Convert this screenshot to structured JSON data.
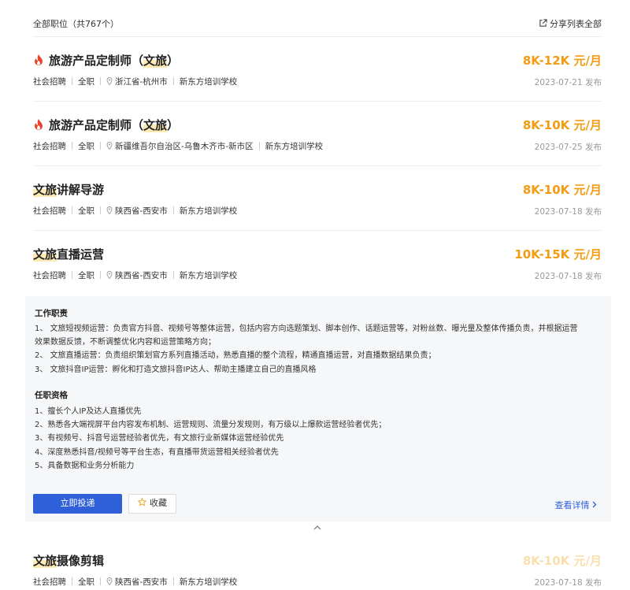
{
  "header": {
    "total_label": "全部职位（共767个）",
    "share_label": "分享列表全部",
    "share_icon": "share-icon"
  },
  "jobs": [
    {
      "hot": true,
      "title_prefix": "旅游产品定制师（",
      "title_highlight": "文旅",
      "title_suffix": "）",
      "salary": "8K-12K 元/月",
      "type": "社会招聘",
      "nature": "全职",
      "location": "浙江省-杭州市",
      "company": "新东方培训学校",
      "date": "2023-07-21 发布"
    },
    {
      "hot": true,
      "title_prefix": "旅游产品定制师（",
      "title_highlight": "文旅",
      "title_suffix": "）",
      "salary": "8K-10K 元/月",
      "type": "社会招聘",
      "nature": "全职",
      "location": "新疆维吾尔自治区-乌鲁木齐市-新市区",
      "company": "新东方培训学校",
      "date": "2023-07-25 发布"
    },
    {
      "hot": false,
      "title_prefix": "",
      "title_highlight": "文旅",
      "title_suffix": "讲解导游",
      "salary": "8K-10K 元/月",
      "type": "社会招聘",
      "nature": "全职",
      "location": "陕西省-西安市",
      "company": "新东方培训学校",
      "date": "2023-07-18 发布"
    },
    {
      "hot": false,
      "title_prefix": "",
      "title_highlight": "文旅",
      "title_suffix": "直播运营",
      "salary": "10K-15K 元/月",
      "type": "社会招聘",
      "nature": "全职",
      "location": "陕西省-西安市",
      "company": "新东方培训学校",
      "date": "2023-07-18 发布"
    },
    {
      "hot": false,
      "title_prefix": "",
      "title_highlight": "文旅",
      "title_suffix": "摄像剪辑",
      "salary": "8K-10K 元/月",
      "type": "社会招聘",
      "nature": "全职",
      "location": "陕西省-西安市",
      "company": "新东方培训学校",
      "date": "2023-07-18 发布"
    }
  ],
  "detail": {
    "duties_title": "工作职责",
    "duties": [
      "1、 文旅短视频运营：负责官方抖音、视频号等整体运营，包括内容方向选题策划、脚本创作、话题运营等，对粉丝数、曝光量及整体传播负责，并根据运营",
      "效果数据反馈，不断调整优化内容和运营策略方向；",
      "2、 文旅直播运营：负责组织策划官方系列直播活动，熟悉直播的整个流程，精通直播运营，对直播数据结果负责；",
      "3、 文旅抖音IP运营：孵化和打造文旅抖音IP达人、帮助主播建立自己的直播风格"
    ],
    "req_title": "任职资格",
    "requirements": [
      "1、擅长个人IP及达人直播优先",
      "2、熟悉各大端视屏平台内容发布机制、运营规则、流量分发规则，有万级以上爆款运营经验者优先；",
      "3、有视频号、抖音号运营经验者优先，有文旅行业新媒体运营经验优先",
      "4、深度熟悉抖音/视频号等平台生态，有直播带货运营相关经验者优先",
      "5、具备数据和业务分析能力"
    ],
    "apply_label": "立即投递",
    "fav_label": "收藏",
    "more_label": "查看详情"
  },
  "colors": {
    "salary": "#f39c12",
    "primary": "#2f5fd9",
    "highlight": "#fde9b3",
    "hot": "#e8442e"
  }
}
